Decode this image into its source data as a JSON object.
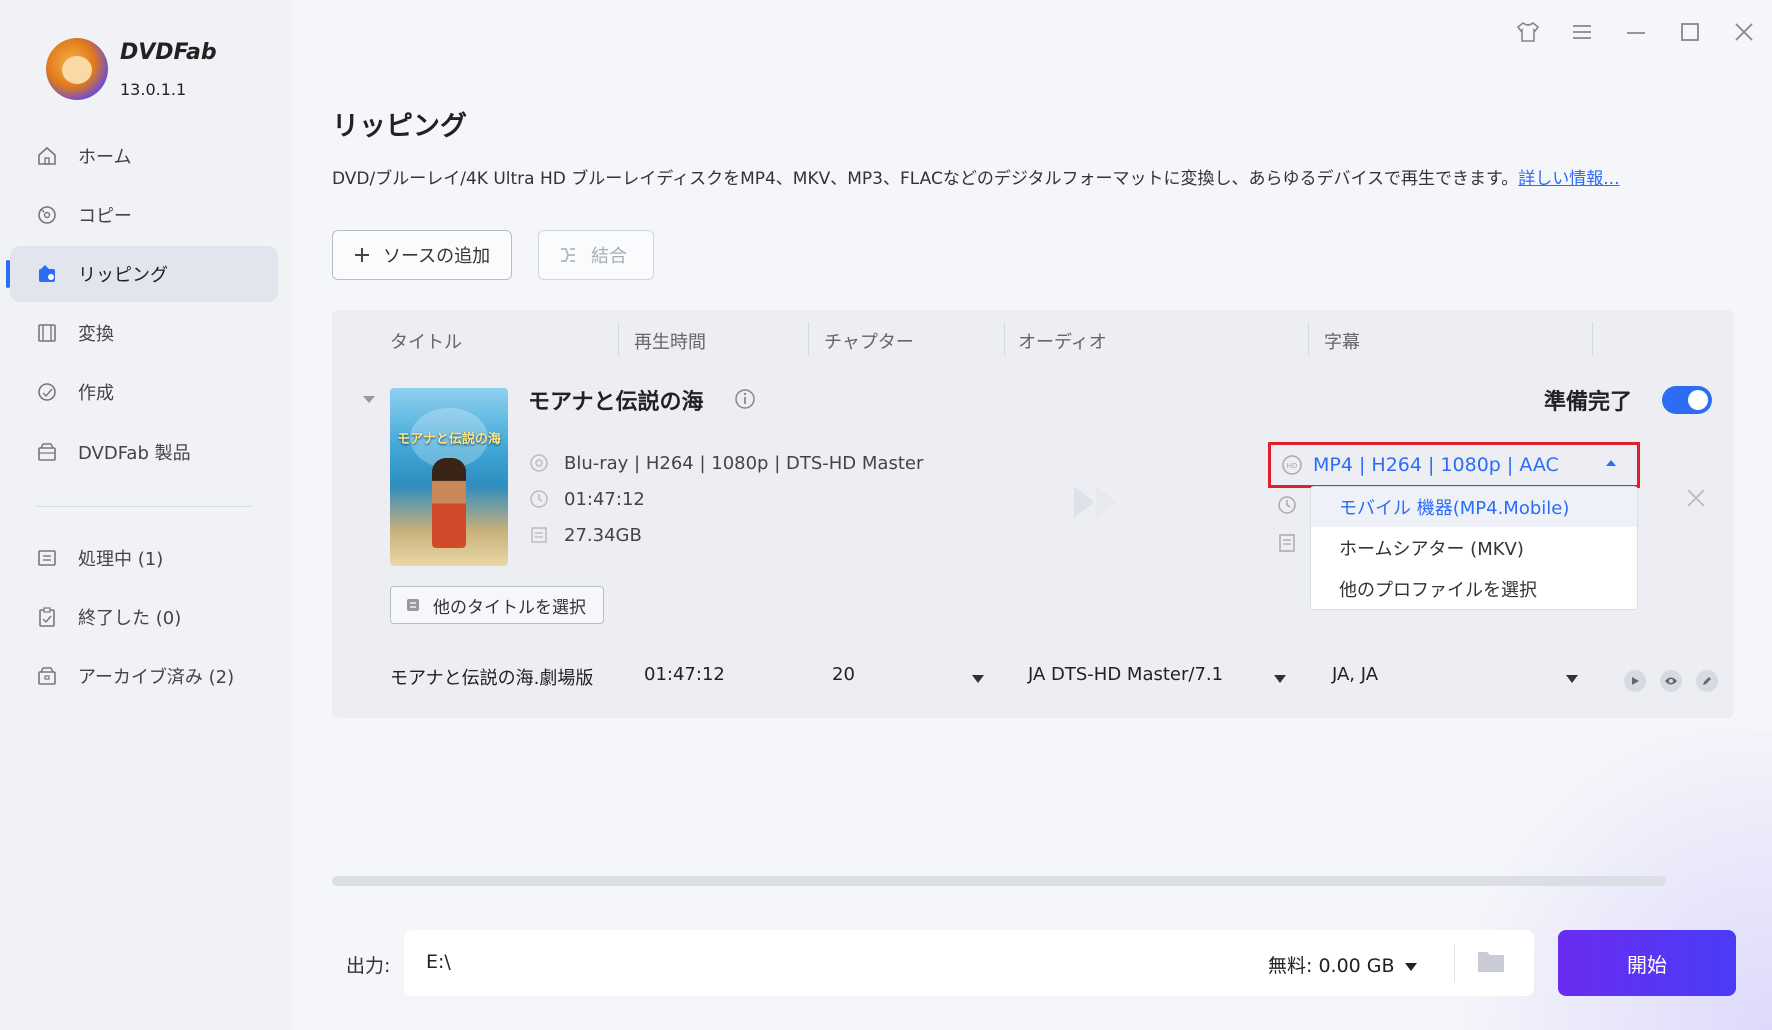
{
  "app": {
    "brand": "DVDFab",
    "version": "13.0.1.1"
  },
  "sidebar": {
    "items": [
      {
        "label": "ホーム",
        "icon": "home-icon"
      },
      {
        "label": "コピー",
        "icon": "copy-icon"
      },
      {
        "label": "リッピング",
        "icon": "ripper-icon",
        "active": true
      },
      {
        "label": "変換",
        "icon": "film-icon"
      },
      {
        "label": "作成",
        "icon": "disc-create-icon"
      },
      {
        "label": "DVDFab 製品",
        "icon": "box-icon"
      }
    ],
    "tasks": [
      {
        "label": "処理中 (1)",
        "icon": "processing-list-icon"
      },
      {
        "label": "終了した (0)",
        "icon": "finished-clipboard-icon"
      },
      {
        "label": "アーカイブ済み (2)",
        "icon": "archive-icon"
      }
    ]
  },
  "header": {
    "title": "リッピング",
    "description": "DVD/ブルーレイ/4K Ultra HD ブルーレイディスクをMP4、MKV、MP3、FLACなどのデジタルフォーマットに変換し、あらゆるデバイスで再生できます。",
    "more_link": "詳しい情報..."
  },
  "toolbar": {
    "add_source": "ソースの追加",
    "merge": "結合"
  },
  "columns": [
    "タイトル",
    "再生時間",
    "チャプター",
    "オーディオ",
    "字幕"
  ],
  "movie": {
    "title": "モアナと伝説の海",
    "poster_text": "モアナと伝説の海",
    "source_info": "Blu-ray | H264 | 1080p | DTS-HD Master",
    "duration": "01:47:12",
    "size": "27.34GB",
    "select_other_titles": "他のタイトルを選択",
    "ready_label": "準備完了",
    "ready_on": true
  },
  "profile": {
    "selected": "MP4 | H264 | 1080p | AAC",
    "options": [
      "モバイル 機器(MP4.Mobile)",
      "ホームシアター (MKV)",
      "他のプロファイルを選択"
    ]
  },
  "title_row": {
    "name": "モアナと伝説の海.劇場版",
    "duration": "01:47:12",
    "chapters": "20",
    "audio": "JA  DTS-HD Master/7.1",
    "subtitles": "JA, JA"
  },
  "output": {
    "label": "出力:",
    "path": "E:\\",
    "free_space": "無料:  0.00 GB"
  },
  "start_button": "開始",
  "colors": {
    "accent": "#2d6df6",
    "start": "#6a2cf0",
    "highlight_box": "#e0202a"
  }
}
